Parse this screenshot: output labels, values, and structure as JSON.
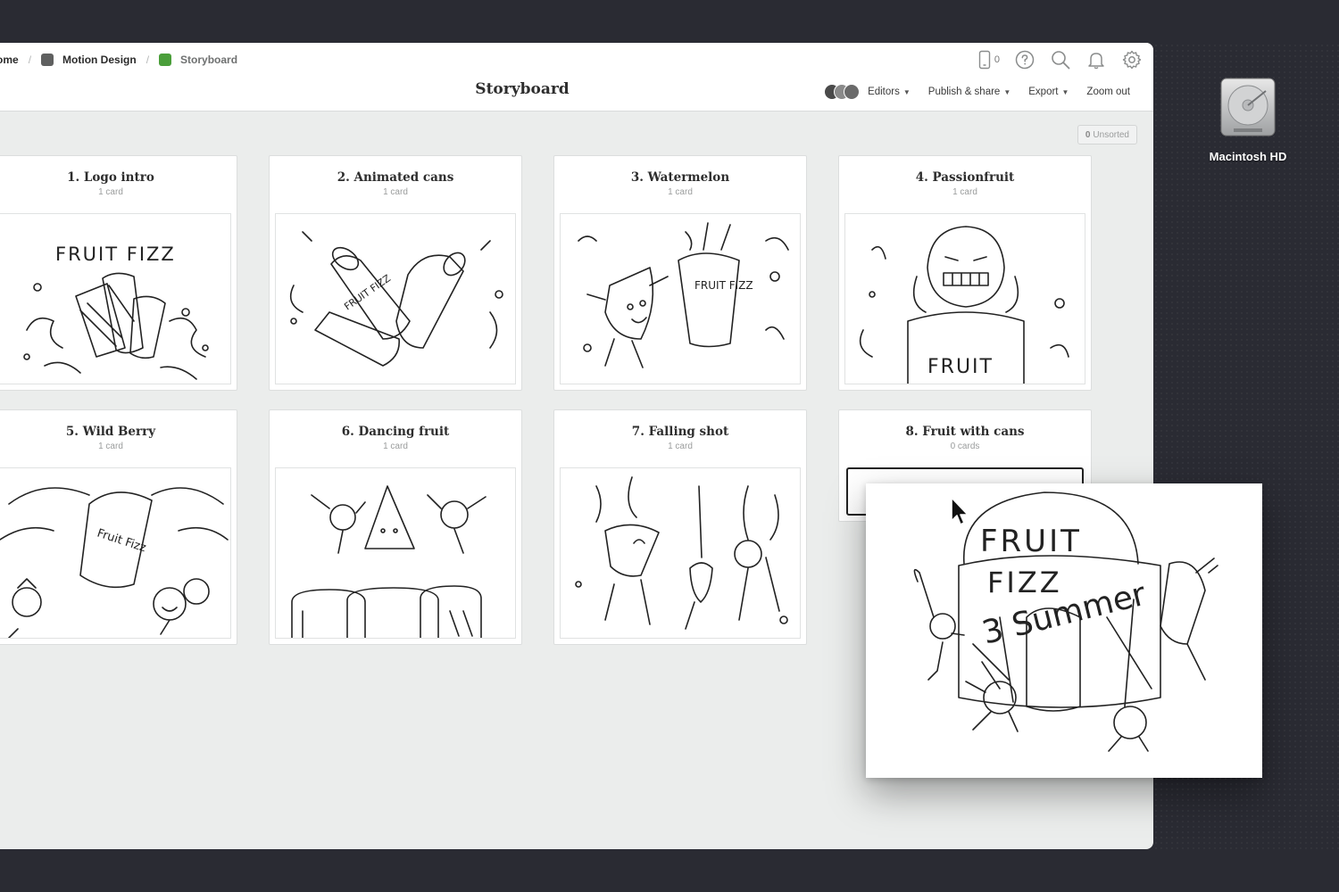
{
  "breadcrumb": {
    "home": "ome",
    "project": "Motion Design",
    "current": "Storyboard",
    "project_color": "#5f6060",
    "current_color": "#4a9e3a"
  },
  "header": {
    "title": "Storyboard",
    "device_count": "0",
    "editors_label": "Editors",
    "publish_label": "Publish & share",
    "export_label": "Export",
    "zoom_label": "Zoom out"
  },
  "unsorted": {
    "count": "0",
    "label": "Unsorted"
  },
  "panels": [
    {
      "title": "1. Logo intro",
      "count": "1 card",
      "sketch_text": "FRUIT FIZZ"
    },
    {
      "title": "2. Animated cans",
      "count": "1 card",
      "sketch_text": "FRUIT FIZZ"
    },
    {
      "title": "3. Watermelon",
      "count": "1 card",
      "sketch_text": "FRUIT FIZZ"
    },
    {
      "title": "4. Passionfruit",
      "count": "1 card",
      "sketch_text": "FRUIT"
    },
    {
      "title": "5. Wild Berry",
      "count": "1 card",
      "sketch_text": "Fruit Fizz"
    },
    {
      "title": "6. Dancing fruit",
      "count": "1 card"
    },
    {
      "title": "7. Falling shot",
      "count": "1 card"
    },
    {
      "title": "8. Fruit with cans",
      "count": "0 cards"
    }
  ],
  "dragged_card": {
    "line1": "FRUIT",
    "line2": "FIZZ",
    "line3": "3 Summer"
  },
  "desktop": {
    "disk_label": "Macintosh HD"
  },
  "colors": {
    "background": "#2a2b33",
    "board": "#ebedec",
    "accent_green": "#4a9e3a"
  }
}
